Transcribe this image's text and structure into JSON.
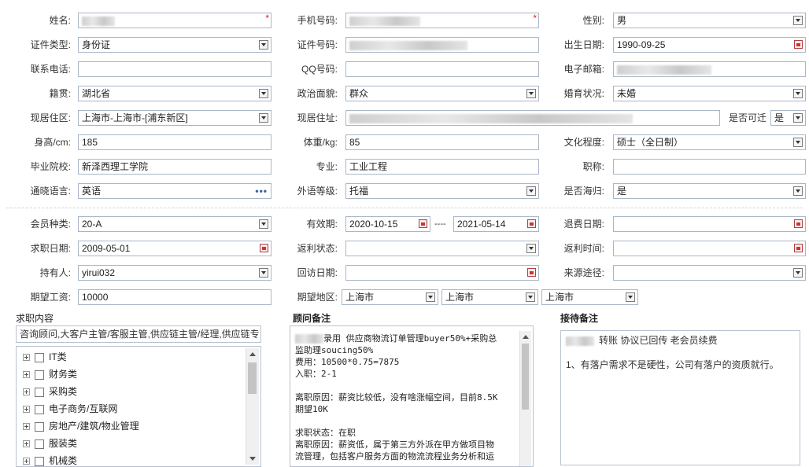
{
  "basic": {
    "name_label": "姓名:",
    "mobile_label": "手机号码:",
    "gender_label": "性别:",
    "gender_value": "男",
    "idtype_label": "证件类型:",
    "idtype_value": "身份证",
    "idno_label": "证件号码:",
    "birth_label": "出生日期:",
    "birth_value": "1990-09-25",
    "phone_label": "联系电话:",
    "qq_label": "QQ号码:",
    "email_label": "电子邮箱:",
    "native_label": "籍贯:",
    "native_value": "湖北省",
    "political_label": "政治面貌:",
    "political_value": "群众",
    "marital_label": "婚育状况:",
    "marital_value": "未婚",
    "residence_label": "现居住区:",
    "residence_value": "上海市-上海市-[浦东新区]",
    "address_label": "现居住址:",
    "relocate_label": "是否可迁",
    "relocate_value": "是",
    "height_label": "身高/cm:",
    "height_value": "185",
    "weight_label": "体重/kg:",
    "weight_value": "85",
    "education_label": "文化程度:",
    "education_value": "硕士（全日制）",
    "school_label": "毕业院校:",
    "school_value": "新泽西理工学院",
    "major_label": "专业:",
    "major_value": "工业工程",
    "title_label": "职称:",
    "language_label": "通晓语言:",
    "language_value": "英语",
    "language_level_label": "外语等级:",
    "language_level_value": "托福",
    "returnee_label": "是否海归:",
    "returnee_value": "是"
  },
  "member": {
    "type_label": "会员种类:",
    "type_value": "20-A",
    "valid_label": "有效期:",
    "valid_from": "2020-10-15",
    "valid_sep": "----",
    "valid_to": "2021-05-14",
    "refund_date_label": "退费日期:",
    "job_date_label": "求职日期:",
    "job_date_value": "2009-05-01",
    "rebate_status_label": "返利状态:",
    "rebate_time_label": "返利时间:",
    "holder_label": "持有人:",
    "holder_value": "yirui032",
    "visit_date_label": "回访日期:",
    "source_label": "来源途径:",
    "salary_label": "期望工资:",
    "salary_value": "10000",
    "area_label": "期望地区:",
    "area_province": "上海市",
    "area_city": "上海市",
    "area_district": "上海市"
  },
  "job": {
    "title": "求职内容",
    "input_value": "咨询顾问,大客户主管/客服主管,供应链主管/经理,供应链专",
    "tree": [
      {
        "label": "IT类"
      },
      {
        "label": "财务类"
      },
      {
        "label": "采购类"
      },
      {
        "label": "电子商务/互联网"
      },
      {
        "label": "房地产/建筑/物业管理"
      },
      {
        "label": "服装类"
      },
      {
        "label": "机械类"
      }
    ]
  },
  "consultant": {
    "title": "顾问备注",
    "lines": [
      "录用  供应商物流订单管理buyer50%+采购总",
      "监助理soucing50%",
      "费用：10500*0.75=7875",
      "入职：2-1",
      "",
      "离职原因：薪资比较低，没有啥涨幅空间，目前8.5K",
      "期望10K",
      "",
      "求职状态：在职",
      "离职原因：薪资低，属于第三方外派在甲方做项目物",
      "流管理，包括客户服务方面的物流流程业务分析和运"
    ]
  },
  "reception": {
    "title": "接待备注",
    "line1": "转账 协议已回传 老会员续费",
    "line2": "1、有落户需求不是硬性，公司有落户的资质就行。"
  }
}
